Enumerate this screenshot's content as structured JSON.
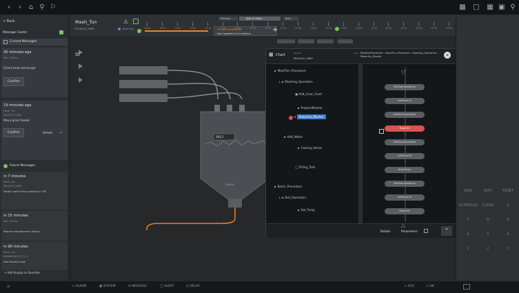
{
  "topbar": {
    "left_icons": [
      "chevron-left-icon",
      "chevron-right-icon",
      "home-icon",
      "pin-icon",
      "bookmark-icon"
    ],
    "right_icons": [
      "chart-icon",
      "window-icon",
      "calculator-icon",
      "display-icon",
      "search-icon"
    ]
  },
  "left_panel": {
    "back_label": "< Back",
    "message_center_label": "Message Center",
    "current_messages_label": "Current Messages",
    "messages": [
      {
        "time": "45 minutes ago",
        "source": "Mon. Zenko",
        "text": "Check heat exchanger",
        "action": "Confirm"
      },
      {
        "time": "19 minutes ago",
        "source": "Mash_Tun",
        "unit": "PALEALE_568V",
        "text": "Move grain feeder",
        "action": "Confirm",
        "details": "Details"
      }
    ],
    "future_messages_label": "Future Messages",
    "future": [
      {
        "time": "in 7 minutes",
        "source": "Mash_Tun",
        "unit": "PALEALE_568V",
        "text": "Switch valve from product in CIP"
      },
      {
        "time": "in 15 minutes",
        "source": "Mon. Zenko",
        "text": "Report maintenance status"
      },
      {
        "time": "in 90 minutes",
        "source": "Mash_Tun",
        "unit": "88888888/2021_1.1",
        "text": "Add Maxtzi malt"
      }
    ],
    "add_display_label": "+ Add display to favorites"
  },
  "unit_bar": {
    "unit_name": "Mash_Tun",
    "unit_batch": "PALEALE_568V",
    "status": "Running",
    "previous_label": "Previous",
    "now_label": "Now 11:35am",
    "next_label": "Next",
    "current_step_label": "SIP_ADD_INGREDIENT",
    "current_step_desc": "Add ingredient A to mashtun",
    "timeline_labels": [
      "10:50",
      "10:55",
      "11:00",
      "11:05",
      "11:10",
      "11:15",
      "11:20",
      "11:25",
      "11:30",
      "11:35",
      "11:40",
      "11:45",
      "11:50",
      "11:55",
      "12:00",
      "12:05",
      "12:10",
      "12:15",
      "12:20",
      "12:25",
      "12:30"
    ]
  },
  "vessel": {
    "temperature_display": "264.2",
    "label": "MASH1"
  },
  "chart_panel": {
    "title": "Chart",
    "unit_label": "Mash5T",
    "unit_batch": "PALEALE_568V",
    "breadcrumb_prefix": "Unit:",
    "breadcrumb": "RelativeProcedure › MashTun_Procedure › Mashing_Operation › PowerUp_Masher",
    "tree": [
      {
        "label": "MashTun_Procedure",
        "level": 0
      },
      {
        "label": "Mashing_Operation",
        "level": 1
      },
      {
        "label": "Add_Grain_Feed",
        "level": 2
      },
      {
        "label": "PrepareMasher",
        "level": 2
      },
      {
        "label": "PowerUp_Masher",
        "level": 2,
        "selected": true
      },
      {
        "label": "Add_Water",
        "level": 1
      },
      {
        "label": "Closing_Valves",
        "level": 2
      },
      {
        "label": "Filling_Tank",
        "level": 2
      },
      {
        "label": "Boiler_Procedure",
        "level": 0
      },
      {
        "label": "Boil_Operation",
        "level": 1
      },
      {
        "label": "Set_Temp",
        "level": 2
      }
    ],
    "sfc_steps": [
      {
        "label": "SetMashSpeedLow",
        "state": "normal"
      },
      {
        "label": "SetPower10",
        "state": "normal"
      },
      {
        "label": "SetMashLowerstate",
        "state": "normal"
      },
      {
        "label": "PowerOn",
        "state": "active"
      },
      {
        "label": "SetMashSpeedMed",
        "state": "normal"
      },
      {
        "label": "SetPower90",
        "state": "normal"
      },
      {
        "label": "MashPower",
        "state": "normal"
      },
      {
        "label": "SetMashSpeedLow",
        "state": "normal"
      },
      {
        "label": "SetPower20",
        "state": "normal"
      },
      {
        "label": "PowerOff",
        "state": "normal"
      }
    ],
    "details_tab": "Details",
    "parameters_tab": "Parameters"
  },
  "right_panel": {
    "keys": [
      [
        "NEW",
        "EDIT",
        "RESET"
      ],
      [
        "SCHEDULE",
        "CLEAR",
        "0"
      ],
      [
        "7",
        "8",
        "9"
      ],
      [
        "4",
        "5",
        "6"
      ],
      [
        "1",
        "2",
        "3"
      ]
    ]
  },
  "bottom_bar": {
    "items": [
      "ALARM",
      "SYSTEM",
      "MESSAGE",
      "ALERT",
      "DELAY"
    ],
    "right_items": [
      "ACK",
      "OK"
    ]
  },
  "colors": {
    "accent_green": "#7cc35a",
    "accent_orange": "#e8862c",
    "selected_blue": "#3f7fcf",
    "active_red": "#d9534f",
    "background": "#1b1d1f"
  }
}
